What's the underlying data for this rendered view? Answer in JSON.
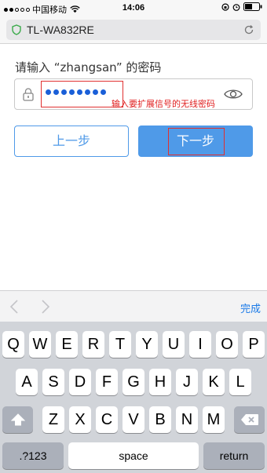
{
  "status_bar": {
    "carrier": "中国移动",
    "time": "14:06"
  },
  "browser": {
    "url": "TL-WA832RE"
  },
  "form": {
    "prompt": "请输入 “zhangsan” 的密码",
    "password_masked_length": 8,
    "annotation": "输入要扩展信号的无线密码",
    "prev_label": "上一步",
    "next_label": "下一步"
  },
  "accessory": {
    "done_label": "完成"
  },
  "keyboard": {
    "row1": [
      "Q",
      "W",
      "E",
      "R",
      "T",
      "Y",
      "U",
      "I",
      "O",
      "P"
    ],
    "row2": [
      "A",
      "S",
      "D",
      "F",
      "G",
      "H",
      "J",
      "K",
      "L"
    ],
    "row3": [
      "Z",
      "X",
      "C",
      "V",
      "B",
      "N",
      "M"
    ],
    "numbers_label": ".?123",
    "space_label": "space",
    "return_label": "return"
  },
  "colors": {
    "accent": "#4f9ae8",
    "annotation": "#e02020",
    "link": "#1a7ae8"
  }
}
